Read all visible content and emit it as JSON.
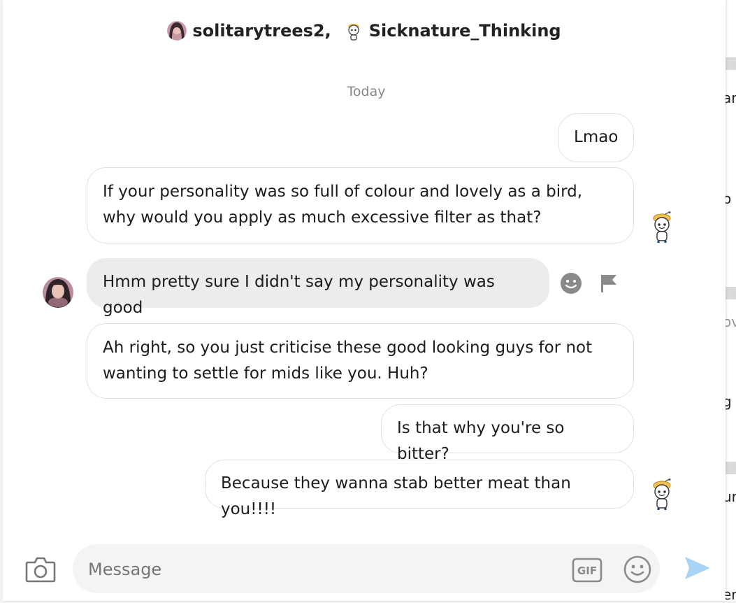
{
  "header": {
    "users": [
      {
        "name": "solitarytrees2,",
        "avatar": "user-avatar"
      },
      {
        "name": "Sicknature_Thinking",
        "avatar": "snoo-avatar"
      }
    ]
  },
  "date_label": "Today",
  "messages": [
    {
      "side": "right",
      "text": "Lmao"
    },
    {
      "side": "right",
      "text": "If your personality was so full of colour and lovely as a bird, why would you apply as much excessive filter as that?"
    },
    {
      "side": "left",
      "text": "Hmm pretty sure I didn't say my personality was good"
    },
    {
      "side": "right",
      "text": "Ah right, so you just criticise these good looking guys for not wanting to settle for mids like you. Huh?"
    },
    {
      "side": "right",
      "text": "Is that why you're so bitter?"
    },
    {
      "side": "right",
      "text": "Because they wanna stab better meat than you!!!!"
    }
  ],
  "composer": {
    "placeholder": "Message",
    "gif_label": "GIF"
  },
  "background_fragments": [
    "ar",
    "o",
    "ov",
    "g",
    "ur",
    "er"
  ],
  "colors": {
    "own_bubble_border": "#e2e2e2",
    "other_bubble_bg": "#ececed",
    "send_icon": "#a9d4f5",
    "icon_gray": "#8a8a8a"
  }
}
